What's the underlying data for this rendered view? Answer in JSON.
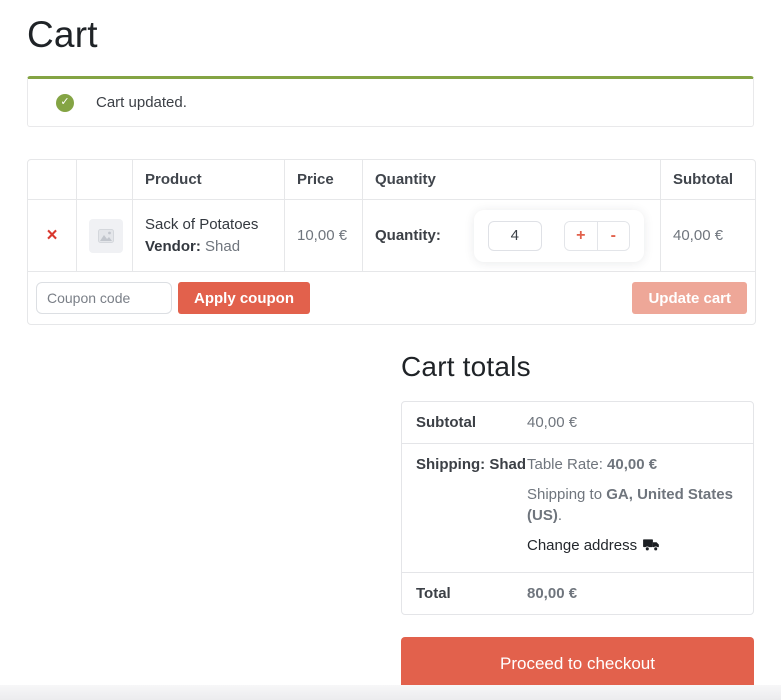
{
  "page": {
    "title": "Cart",
    "notice": {
      "text": "Cart updated.",
      "icon": "check-circle-icon",
      "check_glyph": "✓"
    }
  },
  "cart_table": {
    "headers": {
      "product": "Product",
      "price": "Price",
      "quantity": "Quantity",
      "subtotal": "Subtotal"
    },
    "items": [
      {
        "remove_glyph": "×",
        "thumbnail_icon": "image-placeholder-icon",
        "name": "Sack of Potatoes",
        "vendor_label": "Vendor:",
        "vendor_name": "Shad",
        "price": "10,00 €",
        "quantity_label": "Quantity:",
        "quantity": "4",
        "increase_glyph": "+",
        "decrease_glyph": "-",
        "subtotal": "40,00 €"
      }
    ]
  },
  "coupon": {
    "placeholder": "Coupon code",
    "apply_label": "Apply coupon",
    "update_cart_label": "Update cart"
  },
  "cart_totals": {
    "title": "Cart totals",
    "subtotal": {
      "label": "Subtotal",
      "value": "40,00 €"
    },
    "shipping": {
      "label": "Shipping: Shad",
      "method_prefix": "Table Rate: ",
      "method_amount": "40,00 €",
      "destination_prefix": "Shipping to ",
      "destination_bold": "GA, United States (US)",
      "destination_suffix": ".",
      "change_address_label": "Change address",
      "change_address_icon": "truck-icon"
    },
    "total": {
      "label": "Total",
      "value": "80,00 €"
    },
    "checkout_label": "Proceed to checkout"
  },
  "colors": {
    "accent": "#e2614c",
    "accent_disabled": "#eea798",
    "success_green": "#84a444",
    "remove_red": "#d9382e"
  }
}
